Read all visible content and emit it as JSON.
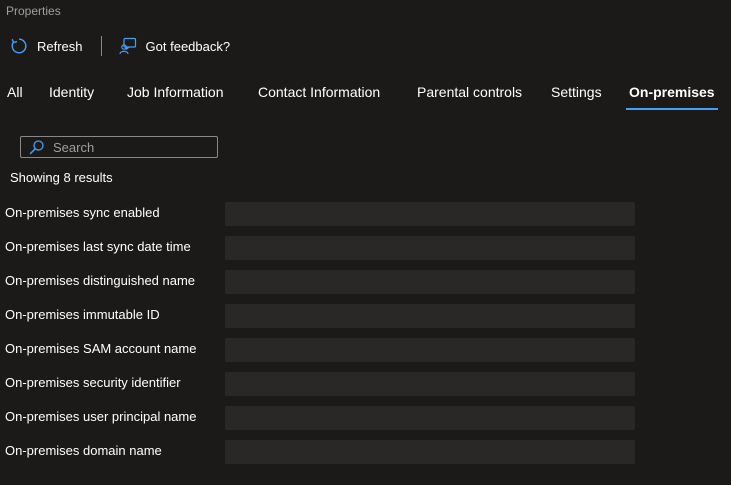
{
  "header": {
    "title": "Properties"
  },
  "toolbar": {
    "refresh_label": "Refresh",
    "feedback_label": "Got feedback?"
  },
  "tabs": [
    {
      "label": "All",
      "active": false
    },
    {
      "label": "Identity",
      "active": false
    },
    {
      "label": "Job Information",
      "active": false
    },
    {
      "label": "Contact Information",
      "active": false
    },
    {
      "label": "Parental controls",
      "active": false
    },
    {
      "label": "Settings",
      "active": false
    },
    {
      "label": "On-premises",
      "active": true
    }
  ],
  "search": {
    "placeholder": "Search",
    "value": ""
  },
  "results": {
    "count_text": "Showing 8 results"
  },
  "properties": [
    {
      "label": "On-premises sync enabled",
      "value": ""
    },
    {
      "label": "On-premises last sync date time",
      "value": ""
    },
    {
      "label": "On-premises distinguished name",
      "value": ""
    },
    {
      "label": "On-premises immutable ID",
      "value": ""
    },
    {
      "label": "On-premises SAM account name",
      "value": ""
    },
    {
      "label": "On-premises security identifier",
      "value": ""
    },
    {
      "label": "On-premises user principal name",
      "value": ""
    },
    {
      "label": "On-premises domain name",
      "value": ""
    }
  ],
  "colors": {
    "background": "#1b1a19",
    "accent": "#479ef5",
    "field_bg": "#292827",
    "muted_text": "#a19f9d"
  },
  "icons": {
    "refresh": "refresh-icon",
    "feedback": "feedback-icon",
    "search": "search-icon"
  }
}
